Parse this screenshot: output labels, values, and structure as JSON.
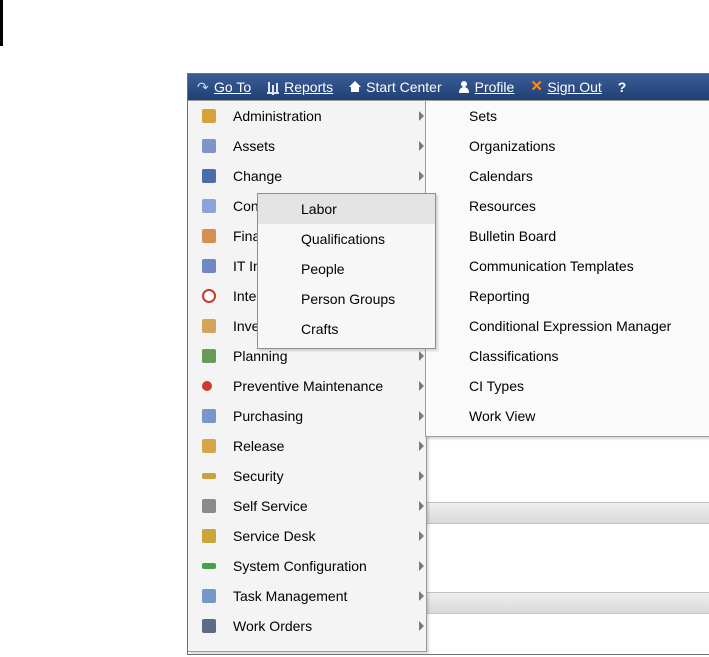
{
  "menubar": {
    "goto": {
      "label": "Go To",
      "icon": "go-to-arrow-icon"
    },
    "reports": {
      "label": "Reports",
      "icon": "reports-chart-icon"
    },
    "start_center": {
      "label": "Start Center",
      "icon": "home-icon"
    },
    "profile": {
      "label": "Profile",
      "icon": "person-icon"
    },
    "sign_out": {
      "label": "Sign Out",
      "icon": "close-x-icon"
    },
    "help": {
      "label": "?"
    }
  },
  "main_menu": {
    "items": [
      {
        "label": "Administration",
        "icon": "administration-icon",
        "color": "#d7a23c"
      },
      {
        "label": "Assets",
        "icon": "assets-icon",
        "color": "#7f94c8"
      },
      {
        "label": "Change",
        "icon": "change-icon",
        "color": "#4b6ea8"
      },
      {
        "label": "Con",
        "icon": "contracts-icon",
        "color": "#8aa3d8"
      },
      {
        "label": "Fina",
        "icon": "financial-icon",
        "color": "#d69050"
      },
      {
        "label": "IT In",
        "icon": "it-infrastructure-icon",
        "color": "#6f88c4"
      },
      {
        "label": "Inte",
        "icon": "integration-icon",
        "color": "#c33a2b"
      },
      {
        "label": "Inve",
        "icon": "inventory-icon",
        "color": "#d4a45a"
      },
      {
        "label": "Planning",
        "icon": "planning-icon",
        "color": "#6a9a59"
      },
      {
        "label": "Preventive Maintenance",
        "icon": "preventive-maintenance-icon",
        "color": "#d03a2a"
      },
      {
        "label": "Purchasing",
        "icon": "purchasing-icon",
        "color": "#7896c9"
      },
      {
        "label": "Release",
        "icon": "release-icon",
        "color": "#d6a54a"
      },
      {
        "label": "Security",
        "icon": "security-key-icon",
        "color": "#caa13e"
      },
      {
        "label": "Self Service",
        "icon": "self-service-icon",
        "color": "#8a8a8a"
      },
      {
        "label": "Service Desk",
        "icon": "service-desk-icon",
        "color": "#c9a53b"
      },
      {
        "label": "System Configuration",
        "icon": "system-configuration-icon",
        "color": "#46a14c"
      },
      {
        "label": "Task Management",
        "icon": "task-management-icon",
        "color": "#7598c8"
      },
      {
        "label": "Work Orders",
        "icon": "work-orders-icon",
        "color": "#5c6b86"
      }
    ]
  },
  "administration_submenu": {
    "items": [
      {
        "label": "Sets"
      },
      {
        "label": "Organizations"
      },
      {
        "label": "Calendars"
      },
      {
        "label": "Resources"
      },
      {
        "label": "Bulletin Board"
      },
      {
        "label": "Communication Templates"
      },
      {
        "label": "Reporting"
      },
      {
        "label": "Conditional Expression Manager"
      },
      {
        "label": "Classifications"
      },
      {
        "label": "CI Types"
      },
      {
        "label": "Work View"
      }
    ]
  },
  "resources_submenu": {
    "items": [
      {
        "label": "Labor",
        "selected": true
      },
      {
        "label": "Qualifications"
      },
      {
        "label": "People"
      },
      {
        "label": "Person Groups"
      },
      {
        "label": "Crafts"
      }
    ]
  },
  "colors": {
    "menubar_bg": "#2a4a80",
    "menu_bg": "#f4f4f4",
    "hover_bg": "#e4e4e4",
    "signout_icon": "#ff8a1e"
  }
}
